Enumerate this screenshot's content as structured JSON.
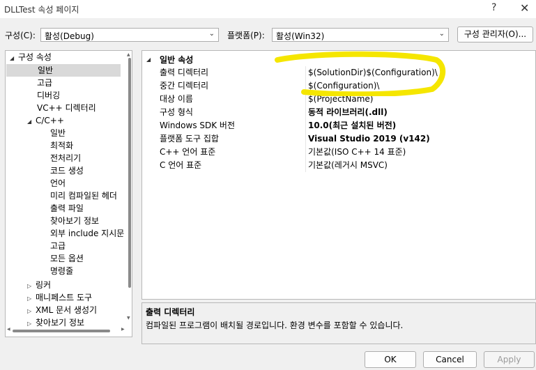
{
  "window": {
    "title": "DLLTest 속성 페이지",
    "help_glyph": "?",
    "close_glyph": "✕"
  },
  "toolbar": {
    "config_label": "구성(C):",
    "config_value": "활성(Debug)",
    "platform_label": "플랫폼(P):",
    "platform_value": "활성(Win32)",
    "config_manager_label": "구성 관리자(O)..."
  },
  "tree": {
    "items": [
      {
        "label": "구성 속성",
        "expander": "◢"
      },
      {
        "label": "일반"
      },
      {
        "label": "고급"
      },
      {
        "label": "디버깅"
      },
      {
        "label": "VC++ 디렉터리"
      },
      {
        "label": "C/C++",
        "expander": "◢"
      },
      {
        "label": "일반"
      },
      {
        "label": "최적화"
      },
      {
        "label": "전처리기"
      },
      {
        "label": "코드 생성"
      },
      {
        "label": "언어"
      },
      {
        "label": "미리 컴파일된 헤더"
      },
      {
        "label": "출력 파일"
      },
      {
        "label": "찾아보기 정보"
      },
      {
        "label": "외부 include 지시문"
      },
      {
        "label": "고급"
      },
      {
        "label": "모든 옵션"
      },
      {
        "label": "명령줄"
      },
      {
        "label": "링커",
        "expander": "▷"
      },
      {
        "label": "매니페스트 도구",
        "expander": "▷"
      },
      {
        "label": "XML 문서 생성기",
        "expander": "▷"
      },
      {
        "label": "찾아보기 정보",
        "expander": "▷"
      }
    ]
  },
  "grid": {
    "category": "일반 속성",
    "category_expander": "◢",
    "rows": [
      {
        "name": "출력 디렉터리",
        "value": "$(SolutionDir)$(Configuration)\\"
      },
      {
        "name": "중간 디렉터리",
        "value": "$(Configuration)\\"
      },
      {
        "name": "대상 이름",
        "value": "$(ProjectName)"
      },
      {
        "name": "구성 형식",
        "value": "동적 라이브러리(.dll)"
      },
      {
        "name": "Windows SDK 버전",
        "value": "10.0(최근 설치된 버전)"
      },
      {
        "name": "플랫폼 도구 집합",
        "value": "Visual Studio 2019 (v142)"
      },
      {
        "name": "C++ 언어 표준",
        "value": "기본값(ISO C++ 14 표준)"
      },
      {
        "name": "C 언어 표준",
        "value": "기본값(레거시 MSVC)"
      }
    ]
  },
  "description": {
    "title": "출력 디렉터리",
    "body": "컴파일된 프로그램이 배치될 경로입니다. 환경 변수를 포함할 수 있습니다."
  },
  "footer": {
    "ok_label": "OK",
    "cancel_label": "Cancel",
    "apply_label": "Apply"
  },
  "colors": {
    "highlight_marker": "#f5e600",
    "selection": "#d9d9d9"
  },
  "icons": {
    "dropdown": "chevron-down-icon",
    "expanded": "triangle-expanded-icon",
    "collapsed": "triangle-collapsed-icon"
  }
}
